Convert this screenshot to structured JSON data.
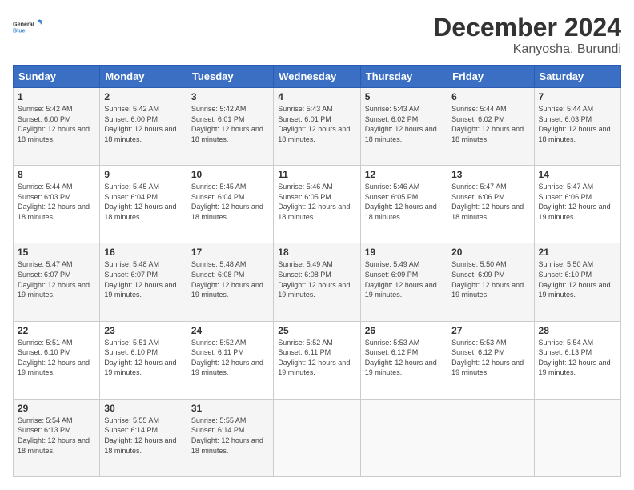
{
  "header": {
    "logo_line1": "General",
    "logo_line2": "Blue",
    "month_title": "December 2024",
    "location": "Kanyosha, Burundi"
  },
  "weekdays": [
    "Sunday",
    "Monday",
    "Tuesday",
    "Wednesday",
    "Thursday",
    "Friday",
    "Saturday"
  ],
  "weeks": [
    [
      {
        "day": "1",
        "info": "Sunrise: 5:42 AM\nSunset: 6:00 PM\nDaylight: 12 hours and 18 minutes."
      },
      {
        "day": "2",
        "info": "Sunrise: 5:42 AM\nSunset: 6:00 PM\nDaylight: 12 hours and 18 minutes."
      },
      {
        "day": "3",
        "info": "Sunrise: 5:42 AM\nSunset: 6:01 PM\nDaylight: 12 hours and 18 minutes."
      },
      {
        "day": "4",
        "info": "Sunrise: 5:43 AM\nSunset: 6:01 PM\nDaylight: 12 hours and 18 minutes."
      },
      {
        "day": "5",
        "info": "Sunrise: 5:43 AM\nSunset: 6:02 PM\nDaylight: 12 hours and 18 minutes."
      },
      {
        "day": "6",
        "info": "Sunrise: 5:44 AM\nSunset: 6:02 PM\nDaylight: 12 hours and 18 minutes."
      },
      {
        "day": "7",
        "info": "Sunrise: 5:44 AM\nSunset: 6:03 PM\nDaylight: 12 hours and 18 minutes."
      }
    ],
    [
      {
        "day": "8",
        "info": "Sunrise: 5:44 AM\nSunset: 6:03 PM\nDaylight: 12 hours and 18 minutes."
      },
      {
        "day": "9",
        "info": "Sunrise: 5:45 AM\nSunset: 6:04 PM\nDaylight: 12 hours and 18 minutes."
      },
      {
        "day": "10",
        "info": "Sunrise: 5:45 AM\nSunset: 6:04 PM\nDaylight: 12 hours and 18 minutes."
      },
      {
        "day": "11",
        "info": "Sunrise: 5:46 AM\nSunset: 6:05 PM\nDaylight: 12 hours and 18 minutes."
      },
      {
        "day": "12",
        "info": "Sunrise: 5:46 AM\nSunset: 6:05 PM\nDaylight: 12 hours and 18 minutes."
      },
      {
        "day": "13",
        "info": "Sunrise: 5:47 AM\nSunset: 6:06 PM\nDaylight: 12 hours and 18 minutes."
      },
      {
        "day": "14",
        "info": "Sunrise: 5:47 AM\nSunset: 6:06 PM\nDaylight: 12 hours and 19 minutes."
      }
    ],
    [
      {
        "day": "15",
        "info": "Sunrise: 5:47 AM\nSunset: 6:07 PM\nDaylight: 12 hours and 19 minutes."
      },
      {
        "day": "16",
        "info": "Sunrise: 5:48 AM\nSunset: 6:07 PM\nDaylight: 12 hours and 19 minutes."
      },
      {
        "day": "17",
        "info": "Sunrise: 5:48 AM\nSunset: 6:08 PM\nDaylight: 12 hours and 19 minutes."
      },
      {
        "day": "18",
        "info": "Sunrise: 5:49 AM\nSunset: 6:08 PM\nDaylight: 12 hours and 19 minutes."
      },
      {
        "day": "19",
        "info": "Sunrise: 5:49 AM\nSunset: 6:09 PM\nDaylight: 12 hours and 19 minutes."
      },
      {
        "day": "20",
        "info": "Sunrise: 5:50 AM\nSunset: 6:09 PM\nDaylight: 12 hours and 19 minutes."
      },
      {
        "day": "21",
        "info": "Sunrise: 5:50 AM\nSunset: 6:10 PM\nDaylight: 12 hours and 19 minutes."
      }
    ],
    [
      {
        "day": "22",
        "info": "Sunrise: 5:51 AM\nSunset: 6:10 PM\nDaylight: 12 hours and 19 minutes."
      },
      {
        "day": "23",
        "info": "Sunrise: 5:51 AM\nSunset: 6:10 PM\nDaylight: 12 hours and 19 minutes."
      },
      {
        "day": "24",
        "info": "Sunrise: 5:52 AM\nSunset: 6:11 PM\nDaylight: 12 hours and 19 minutes."
      },
      {
        "day": "25",
        "info": "Sunrise: 5:52 AM\nSunset: 6:11 PM\nDaylight: 12 hours and 19 minutes."
      },
      {
        "day": "26",
        "info": "Sunrise: 5:53 AM\nSunset: 6:12 PM\nDaylight: 12 hours and 19 minutes."
      },
      {
        "day": "27",
        "info": "Sunrise: 5:53 AM\nSunset: 6:12 PM\nDaylight: 12 hours and 19 minutes."
      },
      {
        "day": "28",
        "info": "Sunrise: 5:54 AM\nSunset: 6:13 PM\nDaylight: 12 hours and 19 minutes."
      }
    ],
    [
      {
        "day": "29",
        "info": "Sunrise: 5:54 AM\nSunset: 6:13 PM\nDaylight: 12 hours and 18 minutes."
      },
      {
        "day": "30",
        "info": "Sunrise: 5:55 AM\nSunset: 6:14 PM\nDaylight: 12 hours and 18 minutes."
      },
      {
        "day": "31",
        "info": "Sunrise: 5:55 AM\nSunset: 6:14 PM\nDaylight: 12 hours and 18 minutes."
      },
      null,
      null,
      null,
      null
    ]
  ]
}
